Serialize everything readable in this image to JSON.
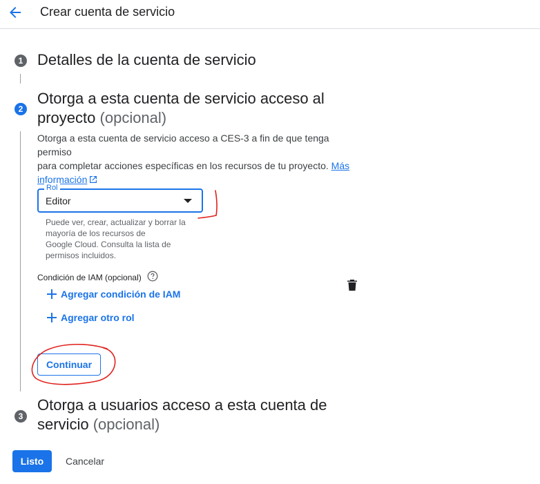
{
  "header": {
    "title": "Crear cuenta de servicio",
    "back_icon": "arrow-back-icon"
  },
  "steps": [
    {
      "number": "1",
      "title": "Detalles de la cuenta de servicio",
      "state": "done"
    },
    {
      "number": "2",
      "title_line1": "Otorga a esta cuenta de servicio acceso al",
      "title_line2": "proyecto",
      "optional": "(opcional)",
      "state": "active"
    },
    {
      "number": "3",
      "title_line1": "Otorga a usuarios acceso a esta cuenta de",
      "title_line2": "servicio",
      "optional": "(opcional)",
      "state": "pending"
    }
  ],
  "step2": {
    "description_line1": "Otorga a esta cuenta de servicio acceso a CES-3 a fin de que tenga permiso",
    "description_line2": "para completar acciones específicas en los recursos de tu proyecto.",
    "link_part1": "Más",
    "link_part2": "información",
    "role": {
      "label": "Rol",
      "value": "Editor",
      "helper_lines": [
        "Puede ver, crear, actualizar y borrar la",
        "mayoría de los recursos de",
        "Google Cloud. Consulta la lista de",
        "permisos incluidos."
      ]
    },
    "iam_condition_label": "Condición de IAM (opcional)",
    "add_condition_label": "Agregar condición de IAM",
    "add_role_label": "Agregar otro rol",
    "continue_label": "Continuar"
  },
  "footer": {
    "done_label": "Listo",
    "cancel_label": "Cancelar"
  },
  "colors": {
    "accent": "#1a73e8",
    "annotation": "#e0201b"
  }
}
